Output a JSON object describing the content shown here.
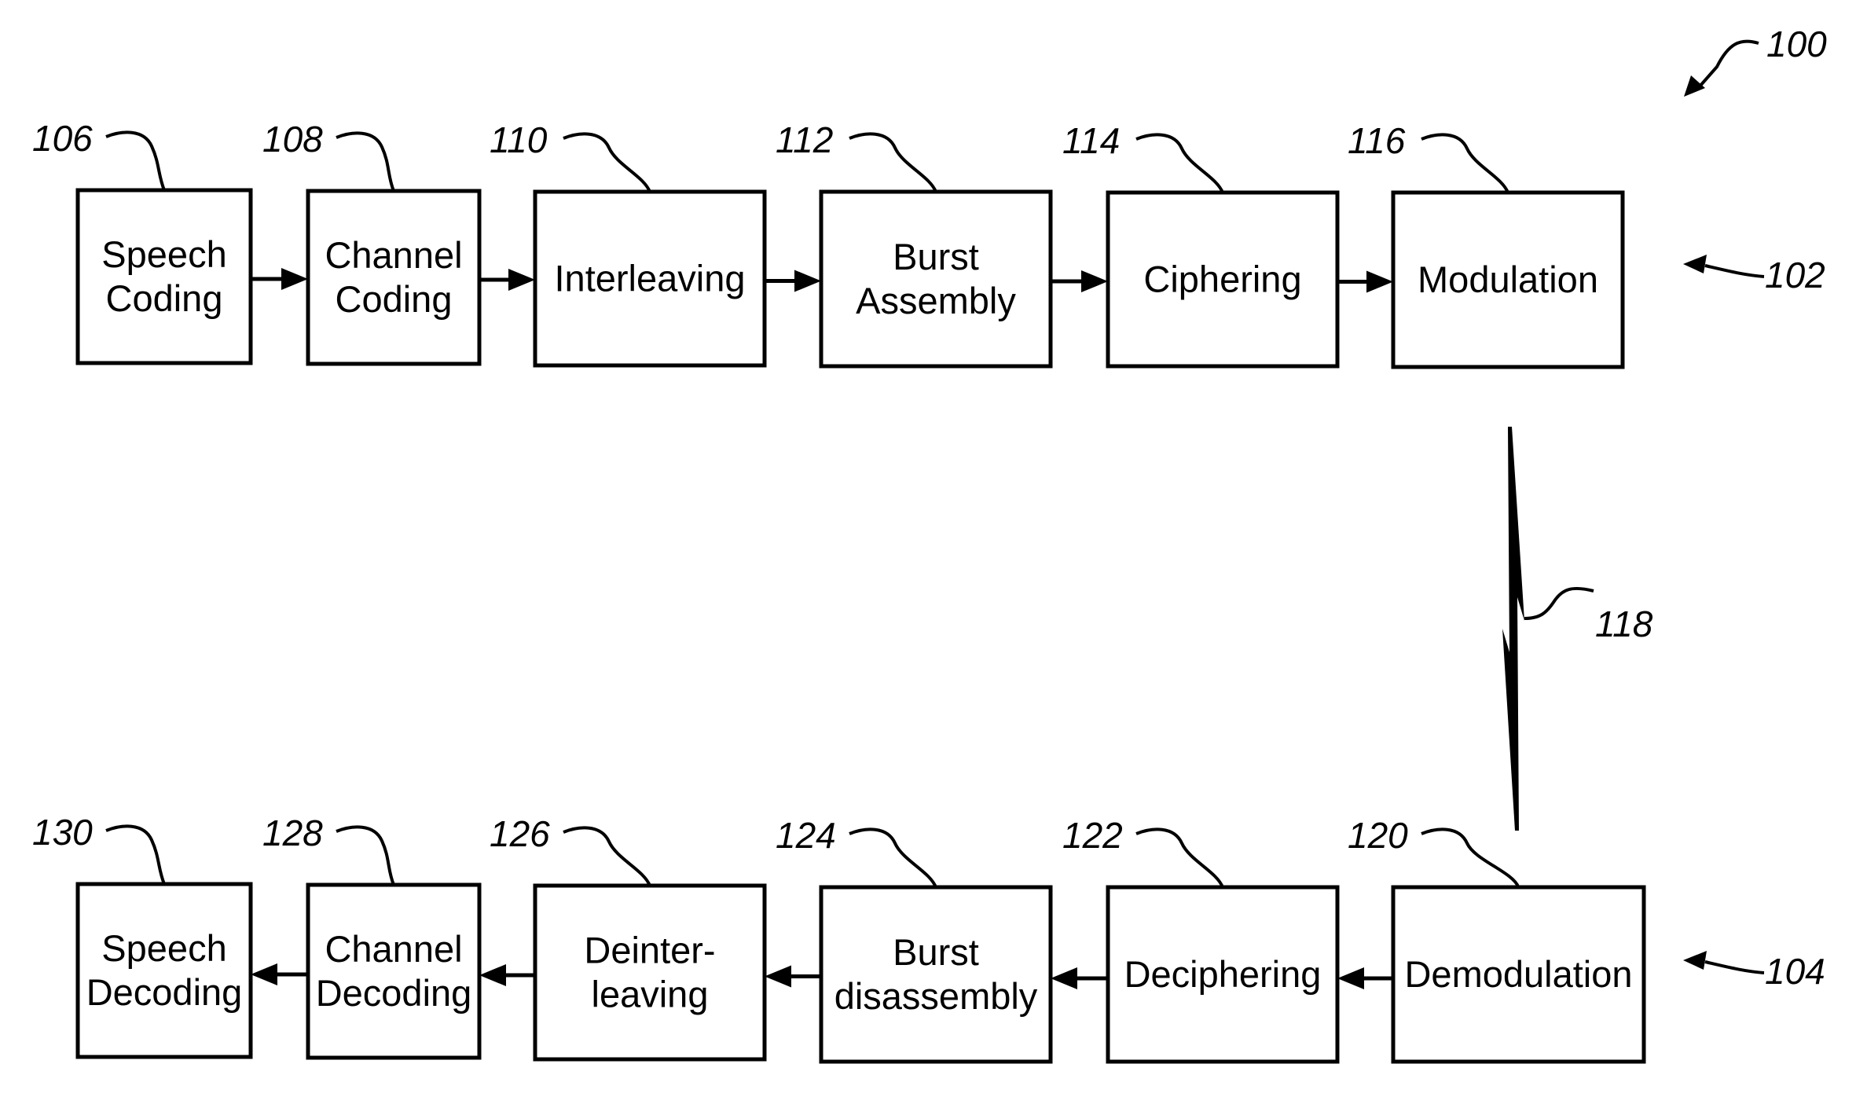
{
  "figure": {
    "ref": "100",
    "transmitter_ref": "102",
    "receiver_ref": "104",
    "channel_ref": "118",
    "channel_icon": "lightning-bolt-icon"
  },
  "transmitter": {
    "blocks": [
      {
        "ref": "106",
        "lines": [
          "Speech",
          "Coding"
        ]
      },
      {
        "ref": "108",
        "lines": [
          "Channel",
          "Coding"
        ]
      },
      {
        "ref": "110",
        "lines": [
          "Interleaving"
        ]
      },
      {
        "ref": "112",
        "lines": [
          "Burst",
          "Assembly"
        ]
      },
      {
        "ref": "114",
        "lines": [
          "Ciphering"
        ]
      },
      {
        "ref": "116",
        "lines": [
          "Modulation"
        ]
      }
    ]
  },
  "receiver": {
    "blocks": [
      {
        "ref": "130",
        "lines": [
          "Speech",
          "Decoding"
        ]
      },
      {
        "ref": "128",
        "lines": [
          "Channel",
          "Decoding"
        ]
      },
      {
        "ref": "126",
        "lines": [
          "Deinter-",
          "leaving"
        ]
      },
      {
        "ref": "124",
        "lines": [
          "Burst",
          "disassembly"
        ]
      },
      {
        "ref": "122",
        "lines": [
          "Deciphering"
        ]
      },
      {
        "ref": "120",
        "lines": [
          "Demodulation"
        ]
      }
    ]
  }
}
